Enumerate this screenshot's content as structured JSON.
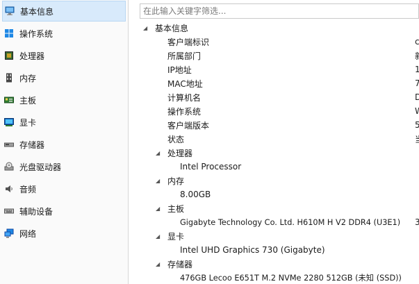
{
  "sidebar": {
    "items": [
      {
        "label": "基本信息",
        "icon": "computer-icon"
      },
      {
        "label": "操作系统",
        "icon": "windows-logo-icon"
      },
      {
        "label": "处理器",
        "icon": "cpu-chip-icon"
      },
      {
        "label": "内存",
        "icon": "memory-module-icon"
      },
      {
        "label": "主板",
        "icon": "motherboard-icon"
      },
      {
        "label": "显卡",
        "icon": "display-card-icon"
      },
      {
        "label": "存储器",
        "icon": "hard-drive-icon"
      },
      {
        "label": "光盘驱动器",
        "icon": "optical-drive-icon"
      },
      {
        "label": "音频",
        "icon": "speaker-icon"
      },
      {
        "label": "辅助设备",
        "icon": "keyboard-icon"
      },
      {
        "label": "网络",
        "icon": "network-icon"
      }
    ]
  },
  "search": {
    "placeholder": "在此输入关键字筛选..."
  },
  "tree": {
    "root": "基本信息",
    "basic_fields": [
      {
        "key": "客户端标识",
        "value": "c"
      },
      {
        "key": "所属部门",
        "value": "新"
      },
      {
        "key": "IP地址",
        "value": "1"
      },
      {
        "key": "MAC地址",
        "value": "7"
      },
      {
        "key": "计算机名",
        "value": "D"
      },
      {
        "key": "操作系统",
        "value": "W"
      },
      {
        "key": "客户端版本",
        "value": "5"
      },
      {
        "key": "状态",
        "value": "当"
      }
    ],
    "groups": [
      {
        "name": "处理器",
        "value": "Intel Processor",
        "extra": ""
      },
      {
        "name": "内存",
        "value": "8.00GB",
        "extra": ""
      },
      {
        "name": "主板",
        "value": "Gigabyte Technology Co. Ltd. H610M H V2 DDR4 (U3E1)",
        "extra": "3"
      },
      {
        "name": "显卡",
        "value": "Intel UHD Graphics 730 (Gigabyte)",
        "extra": ""
      },
      {
        "name": "存储器",
        "value": "476GB Lecoo E651T M.2 NVMe 2280 512GB (未知 (SSD))",
        "extra": ""
      }
    ]
  },
  "colors": {
    "selected_bg": "#d8eafb",
    "selected_border": "#b9d7f3"
  }
}
